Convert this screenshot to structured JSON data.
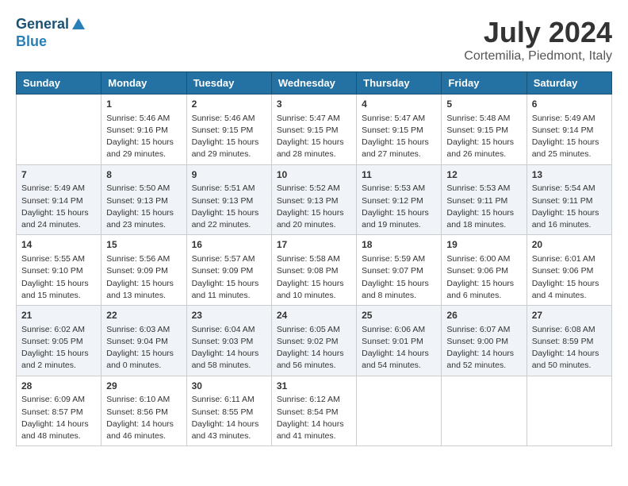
{
  "header": {
    "logo_general": "General",
    "logo_blue": "Blue",
    "main_title": "July 2024",
    "subtitle": "Cortemilia, Piedmont, Italy"
  },
  "calendar": {
    "days_of_week": [
      "Sunday",
      "Monday",
      "Tuesday",
      "Wednesday",
      "Thursday",
      "Friday",
      "Saturday"
    ],
    "weeks": [
      [
        {
          "day": "",
          "info": ""
        },
        {
          "day": "1",
          "info": "Sunrise: 5:46 AM\nSunset: 9:16 PM\nDaylight: 15 hours\nand 29 minutes."
        },
        {
          "day": "2",
          "info": "Sunrise: 5:46 AM\nSunset: 9:15 PM\nDaylight: 15 hours\nand 29 minutes."
        },
        {
          "day": "3",
          "info": "Sunrise: 5:47 AM\nSunset: 9:15 PM\nDaylight: 15 hours\nand 28 minutes."
        },
        {
          "day": "4",
          "info": "Sunrise: 5:47 AM\nSunset: 9:15 PM\nDaylight: 15 hours\nand 27 minutes."
        },
        {
          "day": "5",
          "info": "Sunrise: 5:48 AM\nSunset: 9:15 PM\nDaylight: 15 hours\nand 26 minutes."
        },
        {
          "day": "6",
          "info": "Sunrise: 5:49 AM\nSunset: 9:14 PM\nDaylight: 15 hours\nand 25 minutes."
        }
      ],
      [
        {
          "day": "7",
          "info": "Sunrise: 5:49 AM\nSunset: 9:14 PM\nDaylight: 15 hours\nand 24 minutes."
        },
        {
          "day": "8",
          "info": "Sunrise: 5:50 AM\nSunset: 9:13 PM\nDaylight: 15 hours\nand 23 minutes."
        },
        {
          "day": "9",
          "info": "Sunrise: 5:51 AM\nSunset: 9:13 PM\nDaylight: 15 hours\nand 22 minutes."
        },
        {
          "day": "10",
          "info": "Sunrise: 5:52 AM\nSunset: 9:13 PM\nDaylight: 15 hours\nand 20 minutes."
        },
        {
          "day": "11",
          "info": "Sunrise: 5:53 AM\nSunset: 9:12 PM\nDaylight: 15 hours\nand 19 minutes."
        },
        {
          "day": "12",
          "info": "Sunrise: 5:53 AM\nSunset: 9:11 PM\nDaylight: 15 hours\nand 18 minutes."
        },
        {
          "day": "13",
          "info": "Sunrise: 5:54 AM\nSunset: 9:11 PM\nDaylight: 15 hours\nand 16 minutes."
        }
      ],
      [
        {
          "day": "14",
          "info": "Sunrise: 5:55 AM\nSunset: 9:10 PM\nDaylight: 15 hours\nand 15 minutes."
        },
        {
          "day": "15",
          "info": "Sunrise: 5:56 AM\nSunset: 9:09 PM\nDaylight: 15 hours\nand 13 minutes."
        },
        {
          "day": "16",
          "info": "Sunrise: 5:57 AM\nSunset: 9:09 PM\nDaylight: 15 hours\nand 11 minutes."
        },
        {
          "day": "17",
          "info": "Sunrise: 5:58 AM\nSunset: 9:08 PM\nDaylight: 15 hours\nand 10 minutes."
        },
        {
          "day": "18",
          "info": "Sunrise: 5:59 AM\nSunset: 9:07 PM\nDaylight: 15 hours\nand 8 minutes."
        },
        {
          "day": "19",
          "info": "Sunrise: 6:00 AM\nSunset: 9:06 PM\nDaylight: 15 hours\nand 6 minutes."
        },
        {
          "day": "20",
          "info": "Sunrise: 6:01 AM\nSunset: 9:06 PM\nDaylight: 15 hours\nand 4 minutes."
        }
      ],
      [
        {
          "day": "21",
          "info": "Sunrise: 6:02 AM\nSunset: 9:05 PM\nDaylight: 15 hours\nand 2 minutes."
        },
        {
          "day": "22",
          "info": "Sunrise: 6:03 AM\nSunset: 9:04 PM\nDaylight: 15 hours\nand 0 minutes."
        },
        {
          "day": "23",
          "info": "Sunrise: 6:04 AM\nSunset: 9:03 PM\nDaylight: 14 hours\nand 58 minutes."
        },
        {
          "day": "24",
          "info": "Sunrise: 6:05 AM\nSunset: 9:02 PM\nDaylight: 14 hours\nand 56 minutes."
        },
        {
          "day": "25",
          "info": "Sunrise: 6:06 AM\nSunset: 9:01 PM\nDaylight: 14 hours\nand 54 minutes."
        },
        {
          "day": "26",
          "info": "Sunrise: 6:07 AM\nSunset: 9:00 PM\nDaylight: 14 hours\nand 52 minutes."
        },
        {
          "day": "27",
          "info": "Sunrise: 6:08 AM\nSunset: 8:59 PM\nDaylight: 14 hours\nand 50 minutes."
        }
      ],
      [
        {
          "day": "28",
          "info": "Sunrise: 6:09 AM\nSunset: 8:57 PM\nDaylight: 14 hours\nand 48 minutes."
        },
        {
          "day": "29",
          "info": "Sunrise: 6:10 AM\nSunset: 8:56 PM\nDaylight: 14 hours\nand 46 minutes."
        },
        {
          "day": "30",
          "info": "Sunrise: 6:11 AM\nSunset: 8:55 PM\nDaylight: 14 hours\nand 43 minutes."
        },
        {
          "day": "31",
          "info": "Sunrise: 6:12 AM\nSunset: 8:54 PM\nDaylight: 14 hours\nand 41 minutes."
        },
        {
          "day": "",
          "info": ""
        },
        {
          "day": "",
          "info": ""
        },
        {
          "day": "",
          "info": ""
        }
      ]
    ]
  }
}
